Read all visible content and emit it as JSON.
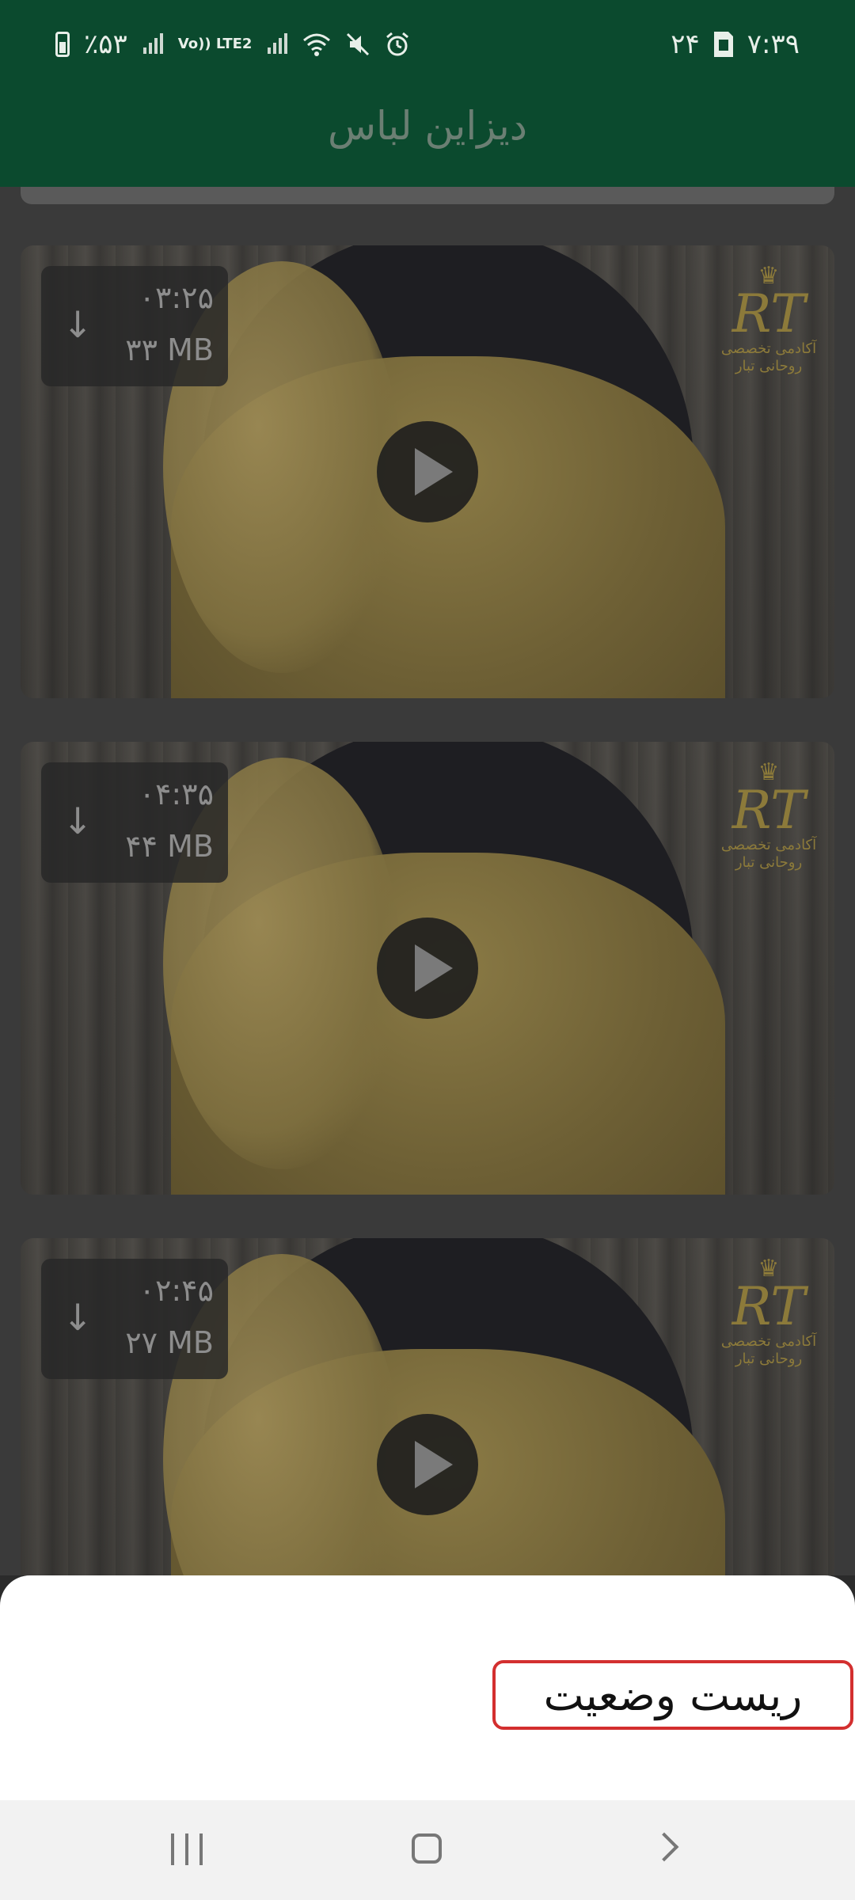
{
  "status_bar": {
    "battery": "٪۵۳",
    "network_label": "Vo)) LTE2",
    "date": "۲۴",
    "time": "۷:۳۹",
    "icons": [
      "battery-icon",
      "signal-icon",
      "lte-icon",
      "signal-icon",
      "wifi-icon",
      "mute-icon",
      "alarm-icon",
      "sim-card-icon"
    ]
  },
  "header": {
    "title": "دیزاین لباس"
  },
  "videos": [
    {
      "duration": "۰۳:۲۵",
      "size": "۳۳ MB"
    },
    {
      "duration": "۰۴:۳۵",
      "size": "۴۴ MB"
    },
    {
      "duration": "۰۲:۴۵",
      "size": "۲۷ MB"
    }
  ],
  "watermark": {
    "logo_text": "RT",
    "line1": "آکادمی تخصصی",
    "line2": "روحانی تبار"
  },
  "bottom_sheet": {
    "reset_label": "ریست وضعیت"
  },
  "colors": {
    "header_bg": "#0b4a2e",
    "highlight_border": "#d32f2f"
  }
}
